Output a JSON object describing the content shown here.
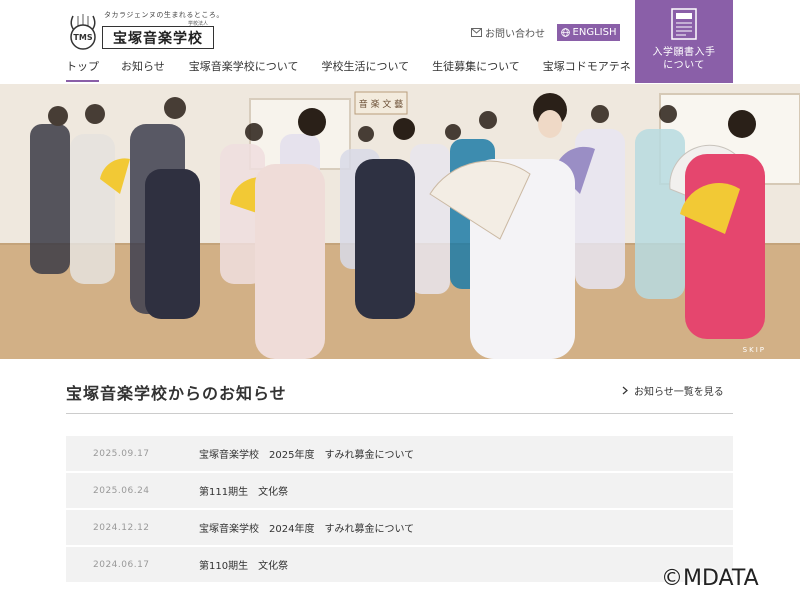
{
  "header": {
    "logo_tagline": "タカラジェンヌの生まれるところ。",
    "logo_sub": "学校法人",
    "logo_name": "宝塚音楽学校",
    "logo_mark": "TMS",
    "contact_label": "お問い合わせ",
    "english_label": "ENGLISH",
    "apply_label_line1": "入学願書入手",
    "apply_label_line2": "について"
  },
  "nav": [
    {
      "label": "トップ",
      "active": true
    },
    {
      "label": "お知らせ",
      "active": false
    },
    {
      "label": "宝塚音楽学校について",
      "active": false
    },
    {
      "label": "学校生活について",
      "active": false
    },
    {
      "label": "生徒募集について",
      "active": false
    },
    {
      "label": "宝塚コドモアテネ",
      "active": false
    }
  ],
  "hero": {
    "skip_label": "SKIP",
    "wall_plaque": "音 楽 文 藝"
  },
  "news": {
    "title": "宝塚音楽学校からのお知らせ",
    "more_label": "お知らせ一覧を見る",
    "items": [
      {
        "date": "2025.09.17",
        "text": "宝塚音楽学校　2025年度　すみれ募金について"
      },
      {
        "date": "2025.06.24",
        "text": "第111期生　文化祭"
      },
      {
        "date": "2024.12.12",
        "text": "宝塚音楽学校　2024年度　すみれ募金について"
      },
      {
        "date": "2024.06.17",
        "text": "第110期生　文化祭"
      }
    ]
  },
  "watermark": "©MDATA",
  "colors": {
    "accent": "#8a5fa8",
    "row_bg": "#f2f2f2",
    "date_text": "#999999"
  }
}
